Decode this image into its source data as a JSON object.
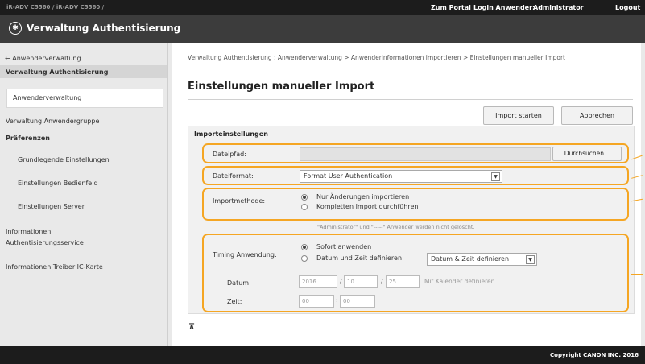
{
  "topbar": {
    "device": "iR-ADV C5560 / iR-ADV C5560 /",
    "portal": "Zum Portal",
    "login_label": "Login Anwender:",
    "user": "Administrator",
    "logout": "Logout"
  },
  "window": {
    "title": "Verwaltung Authentisierung"
  },
  "sidebar": {
    "back": "← Anwenderverwaltung",
    "section_title": "Verwaltung Authentisierung",
    "items": [
      "Anwenderverwaltung",
      "Verwaltung Anwendergruppe"
    ],
    "prefs_title": "Präferenzen",
    "pref_items": [
      "Grundlegende Einstellungen",
      "Einstellungen Bedienfeld",
      "Einstellungen Server"
    ],
    "info_auth_line1": "Informationen",
    "info_auth_line2": "Authentisierungsservice",
    "info_driver": "Informationen Treiber IC-Karte"
  },
  "breadcrumb": "Verwaltung Authentisierung : Anwenderverwaltung > Anwenderinformationen importieren > Einstellungen manueller Import",
  "page_title": "Einstellungen manueller Import",
  "buttons": {
    "start": "Import starten",
    "cancel": "Abbrechen",
    "browse": "Durchsuchen..."
  },
  "import_settings": {
    "heading": "Importeinstellungen",
    "file_path_label": "Dateipfad:",
    "file_path_value": "",
    "file_format_label": "Dateiformat:",
    "file_format_value": "Format User Authentication",
    "method_label": "Importmethode:",
    "method_options": [
      "Nur Änderungen importieren",
      "Kompletten Import durchführen"
    ],
    "method_selected": 0,
    "note": "\"Administrator\" und \"-----\" Anwender werden nicht gelöscht.",
    "timing_label": "Timing Anwendung:",
    "timing_options": [
      "Sofort anwenden",
      "Datum und Zeit definieren"
    ],
    "timing_selected": 0,
    "datetime_select": "Datum & Zeit definieren",
    "date_label": "Datum:",
    "date_year": "2016",
    "date_month": "10",
    "date_day": "25",
    "calendar_link": "Mit Kalender definieren",
    "time_label": "Zeit:",
    "time_hour": "00",
    "time_minute": "00"
  },
  "footer": {
    "copyright": "Copyright CANON INC. 2016"
  },
  "colors": {
    "highlight": "#f5a623",
    "topbar": "#1c1c1c",
    "titlebar": "#3c3c3c"
  }
}
